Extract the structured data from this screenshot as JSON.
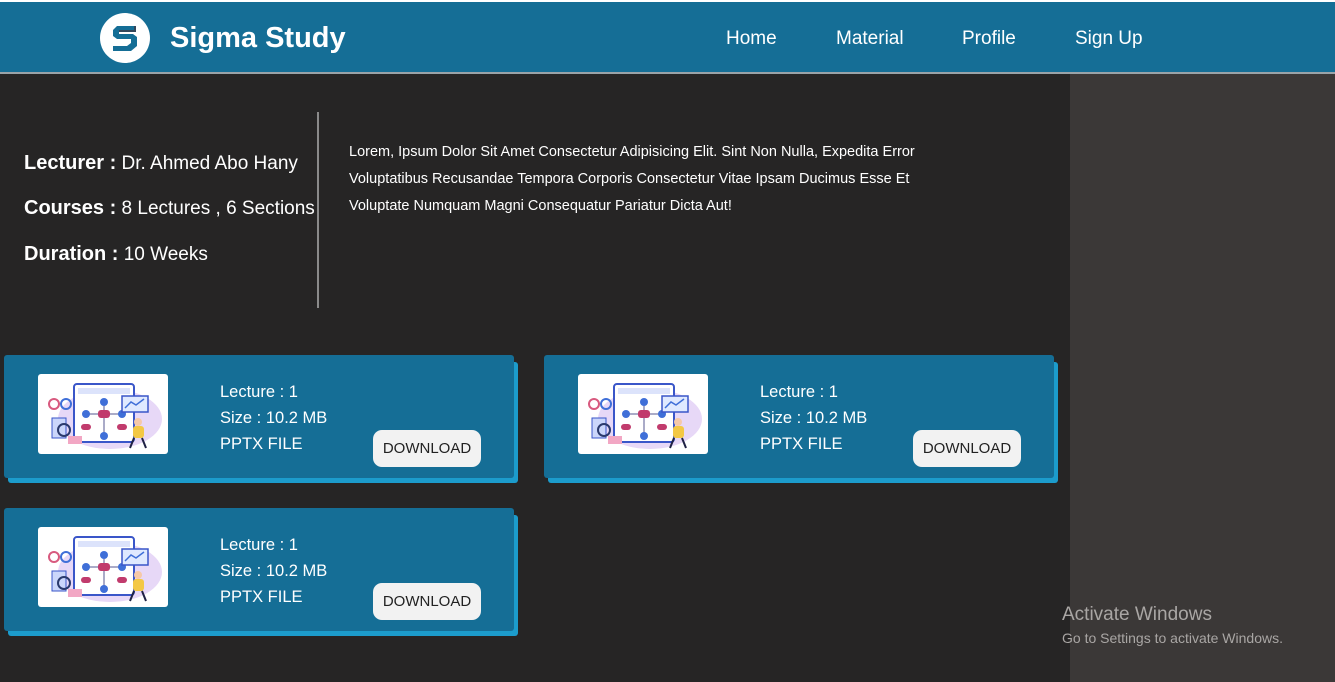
{
  "app": {
    "brand": "Sigma Study",
    "logo_icon": "sigma-s-logo-icon",
    "colors": {
      "primary": "#156e96",
      "accent": "#1c9ccc",
      "background": "#262525",
      "panel": "#3b3837"
    }
  },
  "nav": {
    "items": [
      {
        "label": "Home"
      },
      {
        "label": "Material"
      },
      {
        "label": "Profile"
      },
      {
        "label": "Sign Up"
      }
    ]
  },
  "course": {
    "lecturer_label": "Lecturer :",
    "lecturer_value": " Dr. Ahmed Abo Hany",
    "courses_label": "Courses :",
    "courses_value": " 8 Lectures , 6 Sections",
    "duration_label": "Duration :",
    "duration_value": " 10 Weeks",
    "description": "Lorem, Ipsum Dolor Sit Amet Consectetur Adipisicing Elit. Sint Non Nulla, Expedita Error Voluptatibus Recusandae Tempora Corporis Consectetur Vitae Ipsam Ducimus Esse Et Voluptate Numquam Magni Consequatur Pariatur Dicta Aut!"
  },
  "files": [
    {
      "lecture": "Lecture : 1",
      "size": "Size : 10.2 MB",
      "type": "PPTX FILE",
      "button": "DOWNLOAD",
      "thumb_icon": "flowchart-illustration-icon"
    },
    {
      "lecture": "Lecture : 1",
      "size": "Size : 10.2 MB",
      "type": "PPTX FILE",
      "button": "DOWNLOAD",
      "thumb_icon": "flowchart-illustration-icon"
    },
    {
      "lecture": "Lecture : 1",
      "size": "Size : 10.2 MB",
      "type": "PPTX FILE",
      "button": "DOWNLOAD",
      "thumb_icon": "flowchart-illustration-icon"
    }
  ],
  "watermark": {
    "title": "Activate Windows",
    "subtitle": "Go to Settings to activate Windows."
  }
}
